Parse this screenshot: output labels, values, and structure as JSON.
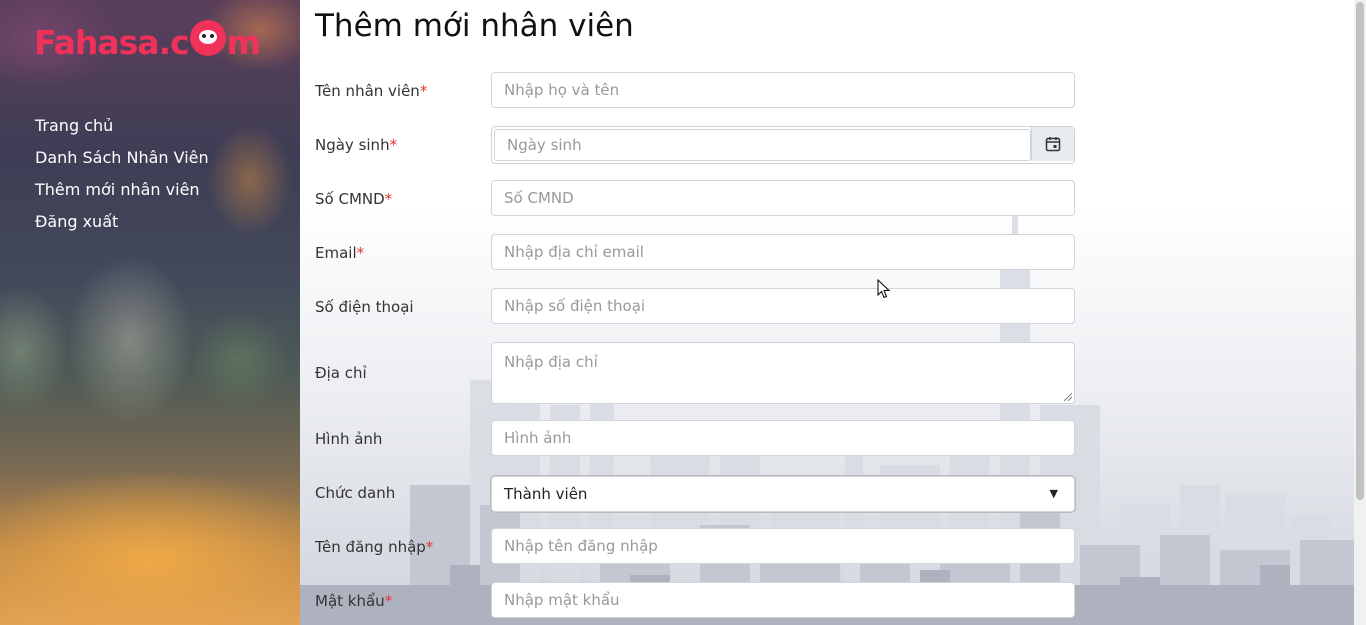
{
  "brand": {
    "logo_text_before": "Fahasa.c",
    "logo_text_after": "m",
    "color": "#f0325a"
  },
  "sidebar": {
    "items": [
      {
        "label": "Trang chủ"
      },
      {
        "label": "Danh Sách Nhân Viên"
      },
      {
        "label": "Thêm mới nhân viên"
      },
      {
        "label": "Đăng xuất"
      }
    ]
  },
  "page": {
    "title": "Thêm mới nhân viên"
  },
  "form": {
    "required_mark": "*",
    "fields": {
      "name": {
        "label": "Tên nhân viên",
        "placeholder": "Nhập họ và tên"
      },
      "dob": {
        "label": "Ngày sinh",
        "placeholder": "Ngày sinh"
      },
      "id_card": {
        "label": "Số CMND",
        "placeholder": "Số CMND"
      },
      "email": {
        "label": "Email",
        "placeholder": "Nhập địa chỉ email"
      },
      "phone": {
        "label": "Số điện thoại",
        "placeholder": "Nhập số điện thoại"
      },
      "address": {
        "label": "Địa chỉ",
        "placeholder": "Nhập địa chỉ"
      },
      "image": {
        "label": "Hình ảnh",
        "placeholder": "Hình ảnh"
      },
      "position": {
        "label": "Chức danh",
        "value": "Thành viên"
      },
      "username": {
        "label": "Tên đăng nhập",
        "placeholder": "Nhập tên đăng nhập"
      },
      "password": {
        "label": "Mật khẩu",
        "placeholder": "Nhập mật khẩu"
      }
    }
  },
  "icons": {
    "calendar": "calendar-icon",
    "dropdown": "caret-down-icon",
    "cursor": "mouse-pointer-icon"
  }
}
